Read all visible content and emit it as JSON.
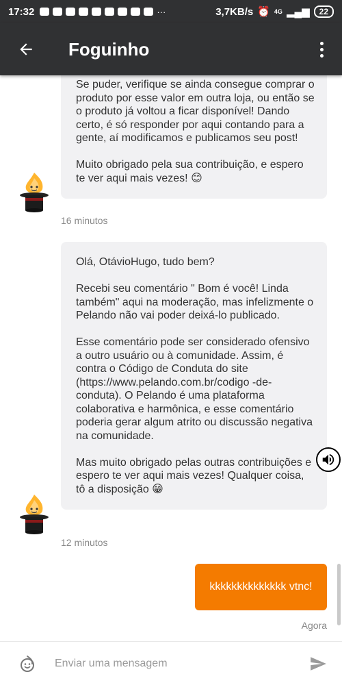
{
  "status_bar": {
    "time": "17:32",
    "dots": "···",
    "speed": "3,7KB/s",
    "network": "4G",
    "battery": "22"
  },
  "app_bar": {
    "title": "Foguinho",
    "back_icon": "arrow-left-icon",
    "menu_icon": "more-vertical-icon",
    "background_color": "#303133"
  },
  "messages": [
    {
      "direction": "incoming",
      "paragraphs": [
        "Se puder, verifique se ainda consegue comprar o produto por esse valor em outra loja, ou então se o produto já voltou a ficar disponível! Dando certo, é só responder por aqui contando para a gente, aí modificamos e publicamos seu post!",
        "Muito obrigado pela sua contribuição, e espero te ver aqui mais vezes! 😊"
      ],
      "time": "16 minutos"
    },
    {
      "direction": "incoming",
      "paragraphs": [
        "Olá, OtávioHugo, tudo bem?",
        "Recebi seu comentário \" Bom é você! Linda também\" aqui na moderação, mas infelizmente o Pelando não vai poder deixá-lo publicado.",
        "Esse comentário pode ser considerado ofensivo a outro usuário ou à comunidade. Assim, é contra o Código de Conduta do site (https://www.pelando.com.br/codigo -de-conduta). O Pelando é uma plataforma colaborativa e harmônica, e esse comentário poderia gerar algum atrito ou discussão negativa na comunidade.",
        "Mas muito obrigado pelas outras contribuições e espero te ver aqui mais vezes! Qualquer coisa, tô a disposição 😁"
      ],
      "time": "12 minutos"
    },
    {
      "direction": "outgoing",
      "text": "kkkkkkkkkkkkkk vtnc!",
      "time": "Agora",
      "color": "#f47b00"
    }
  ],
  "composer": {
    "placeholder": "Enviar uma mensagem",
    "value": "",
    "emoji_icon": "smiley-icon",
    "send_icon": "send-icon"
  }
}
